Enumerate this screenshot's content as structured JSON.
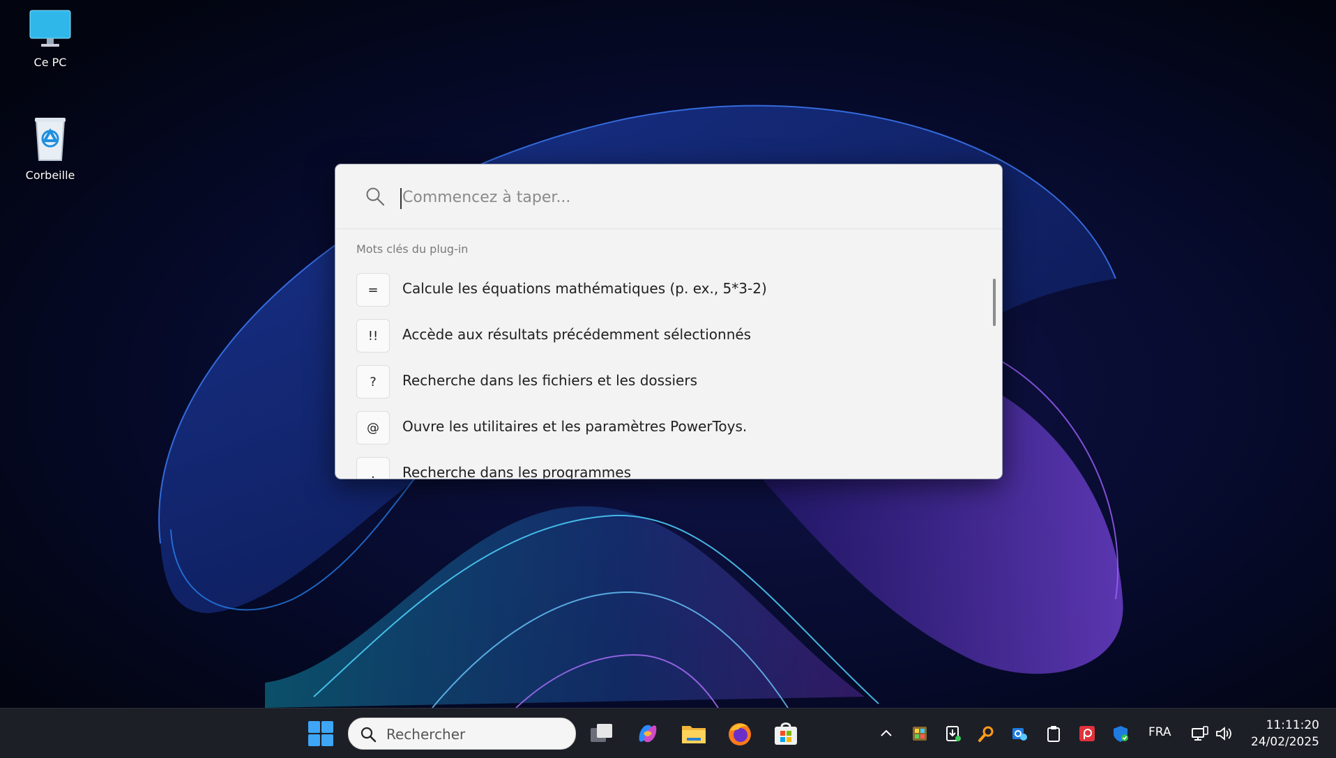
{
  "desktop": {
    "icons": [
      {
        "label": "Ce PC",
        "icon": "monitor-icon"
      },
      {
        "label": "Corbeille",
        "icon": "recycle-bin-icon"
      }
    ]
  },
  "launcher": {
    "search_placeholder": "Commencez à taper...",
    "section_title": "Mots clés du plug-in",
    "results": [
      {
        "key": "=",
        "text": "Calcule les équations mathématiques (p. ex., 5*3-2)"
      },
      {
        "key": "!!",
        "text": "Accède aux résultats précédemment sélectionnés"
      },
      {
        "key": "?",
        "text": "Recherche dans les fichiers et les dossiers"
      },
      {
        "key": "@",
        "text": "Ouvre les utilitaires et les paramètres PowerToys."
      },
      {
        "key": ".",
        "text": "Recherche dans les programmes"
      }
    ]
  },
  "taskbar": {
    "search_label": "Rechercher",
    "apps": [
      "start-icon",
      "task-view-icon",
      "copilot-icon",
      "file-explorer-icon",
      "firefox-icon",
      "store-icon"
    ],
    "tray_icons": [
      "chevron-up-icon",
      "app-icon",
      "download-icon",
      "search-tool-icon",
      "outlook-icon",
      "clipboard-icon",
      "pdf-icon",
      "security-icon"
    ],
    "language": "FRA",
    "time": "11:11:20",
    "date": "24/02/2025"
  },
  "colors": {
    "accent": "#0078d4",
    "taskbar": "#1d1f27",
    "launcher_bg": "#f3f3f3"
  }
}
